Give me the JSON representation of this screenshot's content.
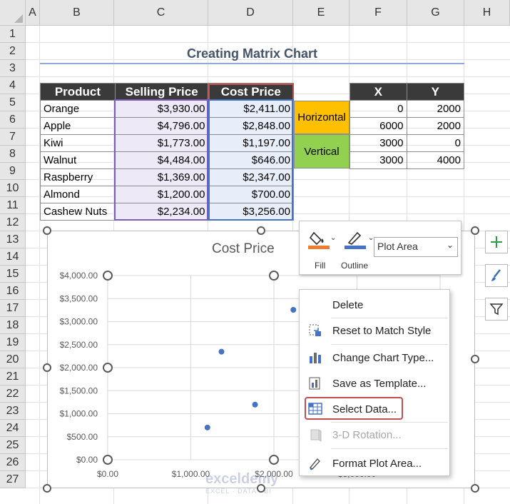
{
  "columns": [
    "A",
    "B",
    "C",
    "D",
    "E",
    "F",
    "G",
    "H"
  ],
  "rows": [
    "1",
    "2",
    "3",
    "4",
    "5",
    "6",
    "7",
    "8",
    "9",
    "10",
    "11",
    "12",
    "13",
    "14",
    "15",
    "16",
    "17",
    "18",
    "19",
    "20",
    "21",
    "22",
    "23",
    "24",
    "25",
    "26",
    "27"
  ],
  "sheet_title": "Creating Matrix Chart",
  "main_table": {
    "headers": [
      "Product",
      "Selling Price",
      "Cost Price"
    ],
    "rows": [
      [
        "Orange",
        "$3,930.00",
        "$2,411.00"
      ],
      [
        "Apple",
        "$4,796.00",
        "$2,848.00"
      ],
      [
        "Kiwi",
        "$1,773.00",
        "$1,197.00"
      ],
      [
        "Walnut",
        "$4,484.00",
        "$646.00"
      ],
      [
        "Raspberry",
        "$1,369.00",
        "$2,347.00"
      ],
      [
        "Almond",
        "$1,200.00",
        "$700.00"
      ],
      [
        "Cashew Nuts",
        "$2,234.00",
        "$3,256.00"
      ]
    ]
  },
  "side_table": {
    "headers": [
      "X",
      "Y"
    ],
    "labels": [
      "Horizontal",
      "Vertical"
    ],
    "label_colors": [
      "#ffc000",
      "#92d050"
    ],
    "rows": [
      [
        "0",
        "2000"
      ],
      [
        "6000",
        "2000"
      ],
      [
        "3000",
        "0"
      ],
      [
        "3000",
        "4000"
      ]
    ]
  },
  "chart_data": {
    "type": "scatter",
    "title": "Cost Price",
    "y_ticks": [
      "$4,000.00",
      "$3,500.00",
      "$3,000.00",
      "$2,500.00",
      "$2,000.00",
      "$1,500.00",
      "$1,000.00",
      "$500.00",
      "$0.00"
    ],
    "x_ticks": [
      "$0.00",
      "$1,000.00",
      "$2,000.00",
      "$3,000.00"
    ],
    "ylim": [
      0,
      4000
    ],
    "x_per_gridline": 1000,
    "series": [
      {
        "points": [
          {
            "x": 3930,
            "y": 2411
          },
          {
            "x": 4796,
            "y": 2848
          },
          {
            "x": 1773,
            "y": 1197
          },
          {
            "x": 4484,
            "y": 646
          },
          {
            "x": 1369,
            "y": 2347
          },
          {
            "x": 1200,
            "y": 700
          },
          {
            "x": 2234,
            "y": 3256
          }
        ]
      }
    ],
    "marker_color": "#4472c4",
    "grid": true
  },
  "format_toolbar": {
    "fill_label": "Fill",
    "outline_label": "Outline",
    "element_selected": "Plot Area"
  },
  "context_menu": {
    "items": [
      {
        "label": "Delete",
        "icon": "none",
        "disabled": false
      },
      {
        "label": "Reset to Match Style",
        "icon": "reset-style-icon",
        "disabled": false
      },
      {
        "label": "Change Chart Type...",
        "icon": "chart-type-icon",
        "disabled": false
      },
      {
        "label": "Save as Template...",
        "icon": "template-icon",
        "disabled": false
      },
      {
        "label": "Select Data...",
        "icon": "select-data-icon",
        "disabled": false,
        "highlighted": true
      },
      {
        "label": "3-D Rotation...",
        "icon": "rotation-icon",
        "disabled": true
      },
      {
        "label": "Format Plot Area...",
        "icon": "format-icon",
        "disabled": false
      }
    ]
  },
  "side_buttons": [
    "add-element-icon",
    "brush-icon",
    "filter-icon"
  ],
  "watermark": "exceldemy",
  "watermark_sub": "EXCEL · DATA · BI",
  "colors": {
    "highlight": "#c0504d",
    "accent": "#4472c4"
  }
}
